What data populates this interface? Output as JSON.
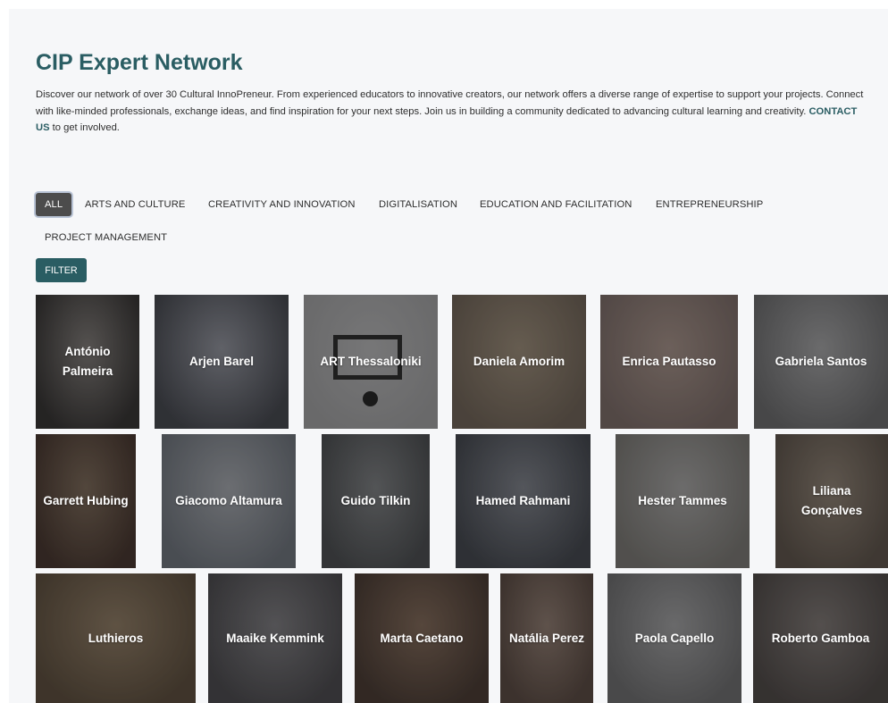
{
  "header": {
    "title": "CIP Expert Network",
    "intro_text": "Discover our network of over 30 Cultural InnoPreneur. From experienced educators to innovative creators, our network offers a diverse range of expertise to support your projects. Connect with like-minded professionals, exchange ideas, and find inspiration for your next steps. Join us in building a community dedicated to advancing cultural learning and creativity.",
    "cta_link": "CONTACT US",
    "cta_suffix": "to get involved."
  },
  "filters": {
    "categories": [
      "ALL",
      "ARTS AND CULTURE",
      "CREATIVITY AND INNOVATION",
      "DIGITALISATION",
      "EDUCATION AND FACILITATION",
      "ENTREPRENEURSHIP",
      "PROJECT MANAGEMENT"
    ],
    "active": "ALL",
    "filter_button": "FILTER"
  },
  "experts": [
    {
      "name": "António Palmeira"
    },
    {
      "name": "Arjen Barel"
    },
    {
      "name": "ART Thessaloniki"
    },
    {
      "name": "Daniela Amorim"
    },
    {
      "name": "Enrica Pautasso"
    },
    {
      "name": "Gabriela Santos"
    },
    {
      "name": "Garrett Hubing"
    },
    {
      "name": "Giacomo Altamura"
    },
    {
      "name": "Guido Tilkin"
    },
    {
      "name": "Hamed Rahmani"
    },
    {
      "name": "Hester Tammes"
    },
    {
      "name": "Liliana Gonçalves"
    },
    {
      "name": "Luthieros"
    },
    {
      "name": "Maaike Kemmink"
    },
    {
      "name": "Marta Caetano"
    },
    {
      "name": "Natália Perez"
    },
    {
      "name": "Paola Capello"
    },
    {
      "name": "Roberto Gamboa"
    }
  ],
  "colors": {
    "accent": "#2a5d63",
    "active_chip": "#4c4c4c",
    "background": "#f6f7f9"
  }
}
